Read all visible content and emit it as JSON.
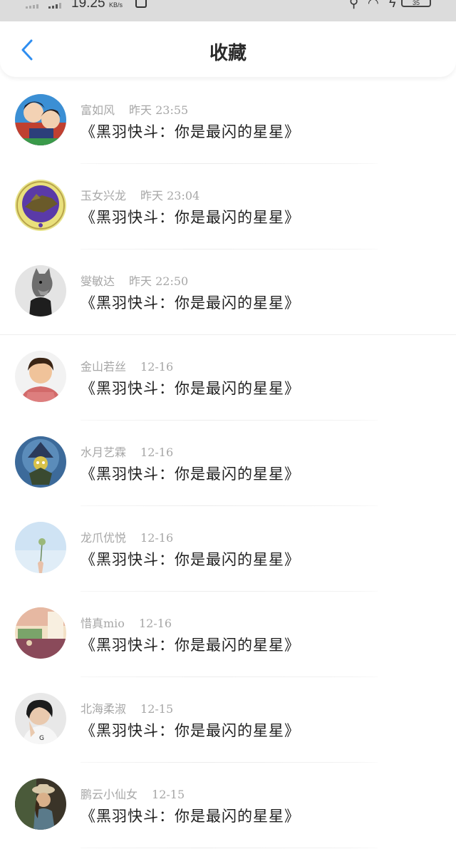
{
  "status_bar": {
    "speed": "19.25",
    "speed_unit": "KB/s",
    "battery": "35"
  },
  "header": {
    "title": "收藏"
  },
  "colors": {
    "accent": "#2f8ef0",
    "name_text": "#a7a7a7",
    "message_text": "#1f1f1f"
  },
  "favorites": [
    {
      "name": "富如风",
      "time": "昨天  23:55",
      "message": "《黑羽快斗：你是最闪的星星》"
    },
    {
      "name": "玉女兴龙",
      "time": "昨天  23:04",
      "message": "《黑羽快斗：你是最闪的星星》"
    },
    {
      "name": "燮敏达",
      "time": "昨天  22:50",
      "message": "《黑羽快斗：你是最闪的星星》"
    },
    {
      "name": "金山若丝",
      "time": "12-16",
      "message": "《黑羽快斗：你是最闪的星星》"
    },
    {
      "name": "水月艺霖",
      "time": "12-16",
      "message": "《黑羽快斗：你是最闪的星星》"
    },
    {
      "name": "龙爪优悦",
      "time": "12-16",
      "message": "《黑羽快斗：你是最闪的星星》"
    },
    {
      "name": "惜真mio",
      "time": "12-16",
      "message": "《黑羽快斗：你是最闪的星星》"
    },
    {
      "name": "北海柔淑",
      "time": "12-15",
      "message": "《黑羽快斗：你是最闪的星星》"
    },
    {
      "name": "鹏云小仙女",
      "time": "12-15",
      "message": "《黑羽快斗：你是最闪的星星》"
    }
  ]
}
